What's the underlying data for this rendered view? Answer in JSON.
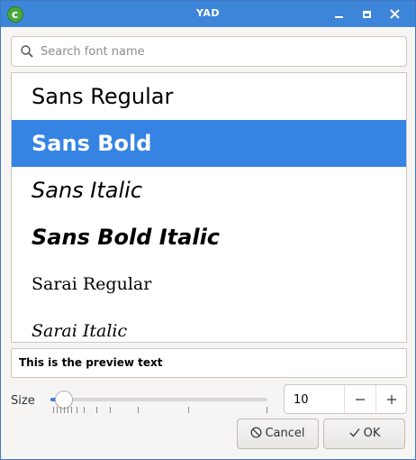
{
  "window": {
    "title": "YAD"
  },
  "search": {
    "placeholder": "Search font name",
    "value": ""
  },
  "fonts": [
    {
      "label": "Sans Regular",
      "selected": false
    },
    {
      "label": "Sans Bold",
      "selected": true
    },
    {
      "label": "Sans Italic",
      "selected": false
    },
    {
      "label": "Sans Bold Italic",
      "selected": false
    },
    {
      "label": "Sarai Regular",
      "selected": false
    },
    {
      "label": "Sarai Italic",
      "selected": false
    }
  ],
  "preview": {
    "text": "This is the preview text"
  },
  "size": {
    "label": "Size",
    "value": "10"
  },
  "buttons": {
    "cancel": "Cancel",
    "ok": "OK"
  },
  "colors": {
    "titlebar": "#3d85d8",
    "selection": "#3584e4",
    "app_icon": "#4ca83e"
  }
}
